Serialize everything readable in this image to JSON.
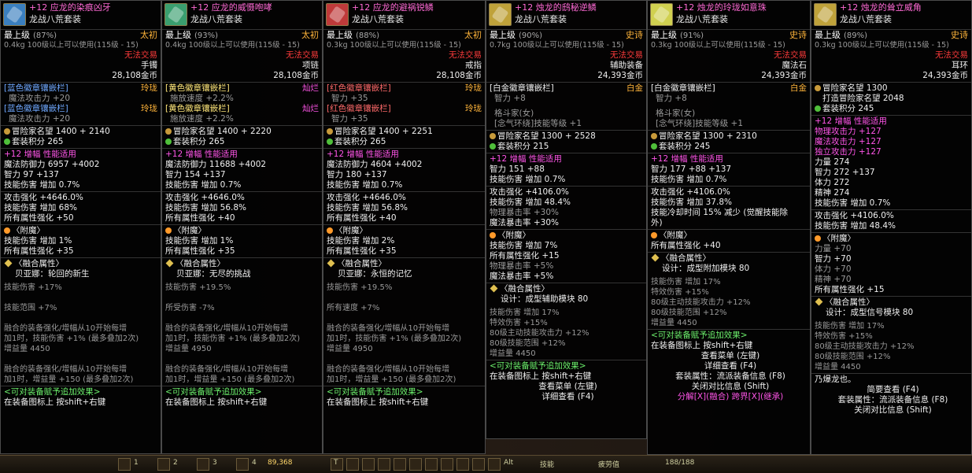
{
  "tooltips": [
    {
      "name": "+12 应龙的染痕凶牙",
      "set": "龙战八荒套装",
      "icon_color": "#3a7fbf",
      "level_label": "最上级",
      "level_pct": "(87%)",
      "rarity": "太初",
      "weight_line": "0.4kg   100级以上可以使用(115级 - 15)",
      "trade": "无法交易",
      "slot_type": "手镯",
      "price": "28,108金币",
      "emblems": [
        {
          "title": "[蓝色徽章镶嵌栏]",
          "grade": "玲珑",
          "stat": "魔法攻击力 +20",
          "title_color": "#6fa8ff",
          "grade_color": "#ffb43a"
        },
        {
          "title": "[蓝色徽章镶嵌栏]",
          "grade": "玲珑",
          "stat": "魔法攻击力 +20",
          "title_color": "#6fa8ff",
          "grade_color": "#ffb43a"
        }
      ],
      "fame": "冒险家名望 1400 + 2140",
      "set_points": "套装积分 265",
      "amp": "+12 增幅  性能适用",
      "base_stats": [
        "魔法防御力 6957 +4002",
        "智力 97 +137",
        "技能伤害 增加 0.7%"
      ],
      "attack": [
        "攻击强化 +4646.0%",
        "技能伤害 增加 68%",
        "所有属性强化 +50"
      ],
      "enchant_title": "〈附魔〉",
      "enchant": [
        "技能伤害 增加 1%",
        "所有属性强化 +35"
      ],
      "fusion_title": "〈融合属性〉",
      "fusion_name": "贝亚娜：轮回的新生",
      "fusion_stats": [
        "技能伤害 +17%",
        "",
        "技能范围 +7%",
        "",
        "融合的装备强化/增幅从10开始每增",
        "加1时，技能伤害 +1% (最多叠加2次)",
        "增益量 4450",
        "",
        "融合的装备强化/增幅从10开始每增",
        "加1时，增益量 +150 (最多叠加2次)"
      ],
      "footer": [
        "<可对装备赋予追加效果>",
        "在装备图标上 按shift+右键"
      ]
    },
    {
      "name": "+12 应龙的威慑咆哮",
      "set": "龙战八荒套装",
      "icon_color": "#3a9f6f",
      "level_label": "最上级",
      "level_pct": "(93%)",
      "rarity": "太初",
      "weight_line": "0.4kg   100级以上可以使用(115级 - 15)",
      "trade": "无法交易",
      "slot_type": "项链",
      "price": "28,108金币",
      "emblems": [
        {
          "title": "[黄色徽章镶嵌栏]",
          "grade": "灿烂",
          "stat": "施放速度 +2.2%",
          "title_color": "#ffe77a",
          "grade_color": "#ff55e8"
        },
        {
          "title": "[黄色徽章镶嵌栏]",
          "grade": "灿烂",
          "stat": "施放速度 +2.2%",
          "title_color": "#ffe77a",
          "grade_color": "#ff55e8"
        }
      ],
      "fame": "冒险家名望 1400 + 2220",
      "set_points": "套装积分 265",
      "amp": "+12 增幅  性能适用",
      "base_stats": [
        "魔法防御力 11688 +4002",
        "智力 154 +137",
        "技能伤害 增加 0.7%"
      ],
      "attack": [
        "攻击强化 +4646.0%",
        "技能伤害 增加 56.8%",
        "所有属性强化 +40"
      ],
      "enchant_title": "〈附魔〉",
      "enchant": [
        "技能伤害 增加 1%",
        "所有属性强化 +35"
      ],
      "fusion_title": "〈融合属性〉",
      "fusion_name": "贝亚娜：无尽的挑战",
      "fusion_stats": [
        "技能伤害 +19.5%",
        "",
        "所受伤害 -7%",
        "",
        "融合的装备强化/增幅从10开始每增",
        "加1时，技能伤害 +1% (最多叠加2次)",
        "增益量 4950",
        "",
        "融合的装备强化/增幅从10开始每增",
        "加1时，增益量 +150 (最多叠加2次)"
      ],
      "footer": [
        "<可对装备赋予追加效果>",
        "在装备图标上 按shift+右键"
      ]
    },
    {
      "name": "+12 应龙的避祸锐鳞",
      "set": "龙战八荒套装",
      "icon_color": "#bf3a3a",
      "level_label": "最上级",
      "level_pct": "(88%)",
      "rarity": "太初",
      "weight_line": "0.3kg   100级以上可以使用(115级 - 15)",
      "trade": "无法交易",
      "slot_type": "戒指",
      "price": "28,108金币",
      "emblems": [
        {
          "title": "[红色徽章镶嵌栏]",
          "grade": "玲珑",
          "stat": "智力 +35",
          "title_color": "#ff6a6a",
          "grade_color": "#ffb43a"
        },
        {
          "title": "[红色徽章镶嵌栏]",
          "grade": "玲珑",
          "stat": "智力 +35",
          "title_color": "#ff6a6a",
          "grade_color": "#ffb43a"
        }
      ],
      "fame": "冒险家名望 1400 + 2251",
      "set_points": "套装积分 265",
      "amp": "+12 增幅  性能适用",
      "base_stats": [
        "魔法防御力 4604 +4002",
        "智力 180 +137",
        "技能伤害 增加 0.7%"
      ],
      "attack": [
        "攻击强化 +4646.0%",
        "技能伤害 增加 56.8%",
        "所有属性强化 +40"
      ],
      "enchant_title": "〈附魔〉",
      "enchant": [
        "技能伤害 增加 2%",
        "所有属性强化 +35"
      ],
      "fusion_title": "〈融合属性〉",
      "fusion_name": "贝亚娜：永恒的记忆",
      "fusion_stats": [
        "技能伤害 +19.5%",
        "",
        "所有速度 +7%",
        "",
        "融合的装备强化/增幅从10开始每增",
        "加1时，技能伤害 +1% (最多叠加2次)",
        "增益量 4950",
        "",
        "融合的装备强化/增幅从10开始每增",
        "加1时，增益量 +150 (最多叠加2次)"
      ],
      "footer": [
        "<可对装备赋予追加效果>",
        "在装备图标上 按shift+右键"
      ]
    },
    {
      "name": "+12 烛龙的鸱秘逆鳞",
      "set": "龙战八荒套装",
      "icon_color": "#bfa23a",
      "level_label": "最上级",
      "level_pct": "(90%)",
      "rarity": "史诗",
      "weight_line": "0.7kg   100级以上可以使用(115级 - 15)",
      "trade": "无法交易",
      "slot_type": "辅助装备",
      "price": "24,393金币",
      "emblems": [
        {
          "title": "[白金徽章镶嵌栏]",
          "grade": "白金",
          "stat": "智力 +8",
          "title_color": "#f0f0f0",
          "grade_color": "#ffb43a"
        }
      ],
      "extra_lines": [
        "格斗家(女)",
        "[念气环绕]技能等级 +1"
      ],
      "fame": "冒险家名望 1300 + 2528",
      "set_points": "套装积分 215",
      "amp": "+12 增幅  性能适用",
      "base_stats": [
        "智力 151 +88",
        "技能伤害 增加 0.7%"
      ],
      "attack": [
        "攻击强化 +4106.0%",
        "技能伤害 增加 48.4%",
        "物理暴击率 +30%",
        "魔法暴击率 +30%"
      ],
      "enchant_title": "〈附魔〉",
      "enchant": [
        "技能伤害 增加 7%",
        "所有属性强化 +15",
        "物理暴击率 +5%",
        "魔法暴击率 +5%"
      ],
      "fusion_title": "〈融合属性〉",
      "fusion_name": "设计：成型辅助模块 80",
      "fusion_stats": [
        "技能伤害 增加 17%",
        "特效伤害 +15%",
        "80级主动技能攻击力 +12%",
        "80级技能范围 +12%",
        "增益量 4450"
      ],
      "footer": [
        "<可对装备赋予追加效果>",
        "在装备图标上 按shift+右键",
        "查看菜单 (左键)",
        "详细查看 (F4)"
      ]
    },
    {
      "name": "+12 烛龙的玲珑如意珠",
      "set": "龙战八荒套装",
      "icon_color": "#d0d050",
      "level_label": "最上级",
      "level_pct": "(91%)",
      "rarity": "史诗",
      "weight_line": "0.3kg   100级以上可以使用(115级 - 15)",
      "trade": "无法交易",
      "slot_type": "魔法石",
      "price": "24,393金币",
      "emblems": [
        {
          "title": "[白金徽章镶嵌栏]",
          "grade": "白金",
          "stat": "智力 +8",
          "title_color": "#f0f0f0",
          "grade_color": "#ffb43a"
        }
      ],
      "extra_lines": [
        "格斗家(女)",
        "[念气环绕]技能等级 +1"
      ],
      "fame": "冒险家名望 1300 + 2310",
      "set_points": "套装积分 245",
      "amp": "+12 增幅  性能适用",
      "base_stats": [
        "智力 177 +88 +137",
        "技能伤害 增加 0.7%"
      ],
      "attack": [
        "攻击强化 +4106.0%",
        "技能伤害 增加 37.8%",
        "技能冷却时间 15% 减少 (觉醒技能除",
        "外)"
      ],
      "enchant_title": "〈附魔〉",
      "enchant": [
        "所有属性强化 +40"
      ],
      "fusion_title": "〈融合属性〉",
      "fusion_name": "设计：成型附加模块 80",
      "fusion_stats": [
        "技能伤害 增加 17%",
        "特效伤害 +15%",
        "80级主动技能攻击力 +12%",
        "80级技能范围 +12%",
        "增益量 4450"
      ],
      "footer": [
        "<可对装备赋予追加效果>",
        "在装备图标上 按shift+右键",
        "查看菜单 (左键)",
        "详细查看 (F4)",
        "套装属性：流派装备信息 (F8)",
        "关闭对比信息 (Shift)",
        "分解[X](融合)  跨界[X](继承)"
      ]
    },
    {
      "name": "+12 烛龙的耸立威角",
      "set": "龙战八荒套装",
      "icon_color": "#bfa23a",
      "level_label": "最上级",
      "level_pct": "(89%)",
      "rarity": "史诗",
      "weight_line": "0.3kg   100级以上可以使用(115级 - 15)",
      "trade": "无法交易",
      "slot_type": "耳环",
      "price": "24,393金币",
      "emblems": [],
      "fame": "冒险家名望 1300",
      "fame2": "打造冒险家名望 2048",
      "set_points": "套装积分 245",
      "amp": "+12 增幅  性能适用",
      "base_stats": [
        "物理攻击力 +127",
        "魔法攻击力 +127",
        "独立攻击力 +127",
        "力量 274",
        "智力 272 +137",
        "体力 272",
        "精神 274",
        "技能伤害 增加 0.7%"
      ],
      "attack": [
        "攻击强化 +4106.0%",
        "技能伤害 增加 48.4%"
      ],
      "enchant_title": "〈附魔〉",
      "enchant": [
        "力量 +70",
        "智力 +70",
        "体力 +70",
        "精神 +70",
        "所有属性强化 +15"
      ],
      "fusion_title": "〈融合属性〉",
      "fusion_name": "设计：成型信号模块 80",
      "fusion_stats": [
        "技能伤害 增加 17%",
        "特效伤害 +15%",
        "80级主动技能攻击力 +12%",
        "80级技能范围 +12%",
        "增益量 4450"
      ],
      "footer": [
        "乃爆龙也。",
        "简要查看 (F4)",
        "套装属性：流派装备信息 (F8)",
        "关闭对比信息 (Shift)"
      ]
    }
  ],
  "hotbar": {
    "gold": "89,368",
    "skill_label": "技能",
    "fatigue_label": "疲劳值",
    "fatigue_value": "188/188",
    "keys": [
      "1",
      "2",
      "3",
      "4",
      "5",
      "6",
      "T",
      "Alt"
    ]
  }
}
